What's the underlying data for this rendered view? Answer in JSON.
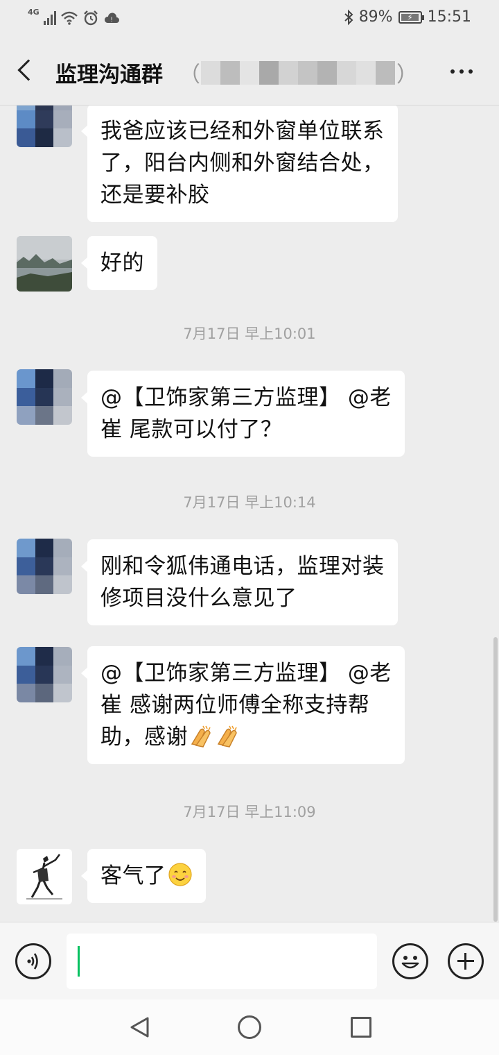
{
  "status_bar": {
    "network": "4G",
    "battery": "89%",
    "time": "15:51"
  },
  "header": {
    "title": "监理沟通群",
    "paren_open": "（",
    "paren_close": "）"
  },
  "messages": [
    {
      "type": "text",
      "lines": [
        "我爸应该已经和外窗单位联系",
        "了，阳台内侧和外窗结合处，",
        "还是要补胶"
      ]
    },
    {
      "type": "text",
      "lines": [
        "好的"
      ]
    },
    {
      "type": "time",
      "text": "7月17日 早上10:01"
    },
    {
      "type": "text",
      "lines": [
        "@【卫饰家第三方监理】 @老",
        "崔  尾款可以付了？"
      ]
    },
    {
      "type": "time",
      "text": "7月17日 早上10:14"
    },
    {
      "type": "text",
      "lines": [
        "刚和令狐伟通电话，监理对装",
        "修项目没什么意见了"
      ]
    },
    {
      "type": "text",
      "lines": [
        "@【卫饰家第三方监理】 @老",
        "崔  感谢两位师傅全称支持帮",
        "助，感谢"
      ],
      "trailing_icons": [
        "clap-icon",
        "clap-icon"
      ]
    },
    {
      "type": "time",
      "text": "7月17日 早上11:09"
    },
    {
      "type": "text",
      "lines": [
        "客气了"
      ],
      "trailing_icons": [
        "smile-icon"
      ]
    }
  ],
  "input_bar": {
    "icons": [
      "voice-icon",
      "emoji-icon",
      "plus-icon"
    ],
    "value": ""
  },
  "colors": {
    "background": "#ededed",
    "bubble": "#ffffff",
    "caret": "#07c160"
  }
}
